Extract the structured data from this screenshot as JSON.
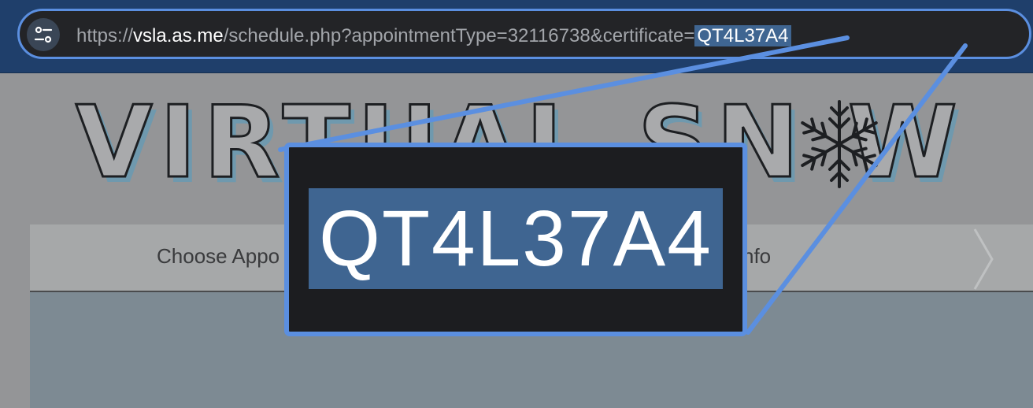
{
  "browser": {
    "url_scheme": "https://",
    "url_host": "vsla.as.me",
    "url_path": "/schedule.php?appointmentType=32116738&certificate=",
    "url_highlighted": "QT4L37A4",
    "site_settings_icon": "tune-icon"
  },
  "page": {
    "logo_text": "VIRTUAL SN  W",
    "logo_icon": "snowflake-icon",
    "tabs": [
      {
        "label": "Choose Appo"
      },
      {
        "label": "nfo"
      }
    ]
  },
  "zoom": {
    "text": "QT4L37A4",
    "accent": "#5b8fe0",
    "highlight": "#3f6591"
  }
}
